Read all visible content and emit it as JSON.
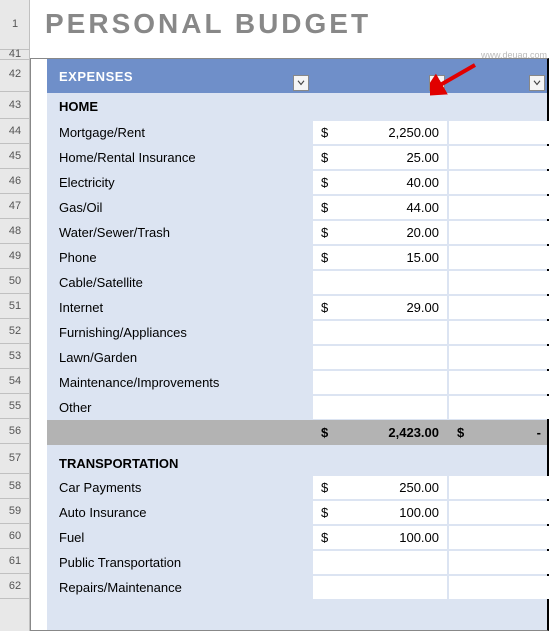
{
  "title": "PERSONAL BUDGET",
  "row_headers_top": [
    "1",
    "41"
  ],
  "row_headers": [
    "42",
    "43",
    "44",
    "45",
    "46",
    "47",
    "48",
    "49",
    "50",
    "51",
    "52",
    "53",
    "54",
    "55",
    "56",
    "57",
    "58",
    "59",
    "60",
    "61",
    "62"
  ],
  "header_label": "EXPENSES",
  "watermark": "www.deuaq.com",
  "sections": {
    "home": {
      "title": "HOME",
      "items": [
        {
          "label": "Mortgage/Rent",
          "c1_cur": "$",
          "c1_val": "2,250.00",
          "c2_cur": "",
          "c2_val": ""
        },
        {
          "label": "Home/Rental Insurance",
          "c1_cur": "$",
          "c1_val": "25.00",
          "c2_cur": "",
          "c2_val": ""
        },
        {
          "label": "Electricity",
          "c1_cur": "$",
          "c1_val": "40.00",
          "c2_cur": "",
          "c2_val": ""
        },
        {
          "label": "Gas/Oil",
          "c1_cur": "$",
          "c1_val": "44.00",
          "c2_cur": "",
          "c2_val": ""
        },
        {
          "label": "Water/Sewer/Trash",
          "c1_cur": "$",
          "c1_val": "20.00",
          "c2_cur": "",
          "c2_val": ""
        },
        {
          "label": "Phone",
          "c1_cur": "$",
          "c1_val": "15.00",
          "c2_cur": "",
          "c2_val": ""
        },
        {
          "label": "Cable/Satellite",
          "c1_cur": "",
          "c1_val": "",
          "c2_cur": "",
          "c2_val": ""
        },
        {
          "label": "Internet",
          "c1_cur": "$",
          "c1_val": "29.00",
          "c2_cur": "",
          "c2_val": ""
        },
        {
          "label": "Furnishing/Appliances",
          "c1_cur": "",
          "c1_val": "",
          "c2_cur": "",
          "c2_val": ""
        },
        {
          "label": "Lawn/Garden",
          "c1_cur": "",
          "c1_val": "",
          "c2_cur": "",
          "c2_val": ""
        },
        {
          "label": "Maintenance/Improvements",
          "c1_cur": "",
          "c1_val": "",
          "c2_cur": "",
          "c2_val": ""
        },
        {
          "label": "Other",
          "c1_cur": "",
          "c1_val": "",
          "c2_cur": "",
          "c2_val": ""
        }
      ],
      "subtotal": {
        "c1_cur": "$",
        "c1_val": "2,423.00",
        "c2_cur": "$",
        "c2_val": "-"
      }
    },
    "transportation": {
      "title": "TRANSPORTATION",
      "items": [
        {
          "label": "Car Payments",
          "c1_cur": "$",
          "c1_val": "250.00",
          "c2_cur": "",
          "c2_val": ""
        },
        {
          "label": "Auto Insurance",
          "c1_cur": "$",
          "c1_val": "100.00",
          "c2_cur": "",
          "c2_val": ""
        },
        {
          "label": "Fuel",
          "c1_cur": "$",
          "c1_val": "100.00",
          "c2_cur": "",
          "c2_val": ""
        },
        {
          "label": "Public Transportation",
          "c1_cur": "",
          "c1_val": "",
          "c2_cur": "",
          "c2_val": ""
        },
        {
          "label": "Repairs/Maintenance",
          "c1_cur": "",
          "c1_val": "",
          "c2_cur": "",
          "c2_val": ""
        }
      ]
    }
  }
}
